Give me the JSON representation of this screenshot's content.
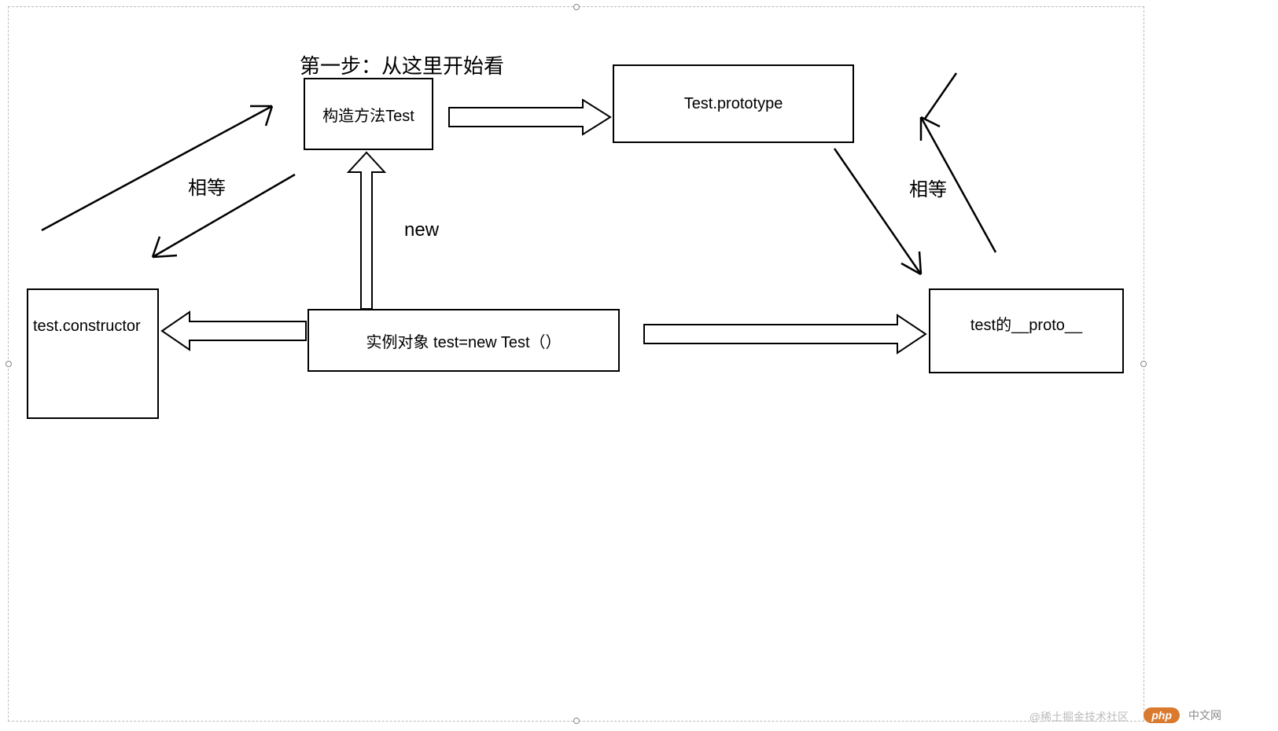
{
  "title_label": "第一步：从这里开始看",
  "boxes": {
    "constructor_box": "构造方法Test",
    "prototype_box": "Test.prototype",
    "test_constructor_box": "test.constructor",
    "instance_box": "实例对象 test=new Test（）",
    "proto_box": "test的__proto__"
  },
  "labels": {
    "equal_left": "相等",
    "equal_right": "相等",
    "new_label": "new"
  },
  "watermark": {
    "juejin": "@稀土掘金技术社区",
    "php_badge": "php",
    "php_site": "中文网"
  }
}
